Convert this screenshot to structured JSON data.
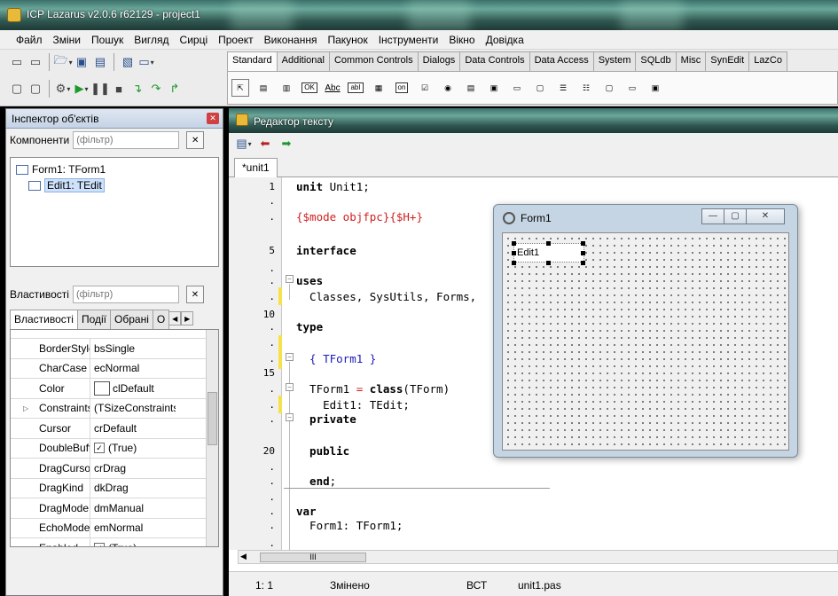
{
  "app": {
    "title": "ICP Lazarus v2.0.6 r62129 - project1"
  },
  "menu": [
    "Файл",
    "Зміни",
    "Пошук",
    "Вигляд",
    "Сирці",
    "Проект",
    "Виконання",
    "Пакунок",
    "Інструменти",
    "Вікно",
    "Довідка"
  ],
  "palette": {
    "tabs": [
      "Standard",
      "Additional",
      "Common Controls",
      "Dialogs",
      "Data Controls",
      "Data Access",
      "System",
      "SQLdb",
      "Misc",
      "SynEdit",
      "LazCo"
    ],
    "active_tab": "Standard",
    "components": [
      "pointer",
      "TMainMenu",
      "TPopupMenu",
      "TButton",
      "TLabel",
      "TEdit",
      "TMemo",
      "TToggleBox",
      "TCheckBox",
      "TRadioButton",
      "TListBox",
      "TComboBox",
      "TScrollBar",
      "TGroupBox",
      "TRadioGroup",
      "TCheckGroup",
      "TPanel",
      "TFrame",
      "TActionList"
    ],
    "labels": {
      "ok": "OK",
      "abc": "Abc",
      "abl": "abI",
      "on": "on"
    }
  },
  "inspector": {
    "title": "Інспектор об'єктів",
    "components_label": "Компоненти",
    "components_filter_placeholder": "(фільтр)",
    "tree": [
      {
        "label": "Form1: TForm1",
        "level": 0
      },
      {
        "label": "Edit1: TEdit",
        "level": 1,
        "selected": true
      }
    ],
    "properties_label": "Властивості",
    "properties_filter_placeholder": "(фільтр)",
    "tabs": [
      "Властивості",
      "Події",
      "Обрані",
      "О"
    ],
    "properties": [
      {
        "name": "BorderStyle",
        "value": "bsSingle"
      },
      {
        "name": "CharCase",
        "value": "ecNormal"
      },
      {
        "name": "Color",
        "value": "clDefault",
        "swatch": true
      },
      {
        "name": "Constraints",
        "value": "(TSizeConstraints)",
        "expandable": true
      },
      {
        "name": "Cursor",
        "value": "crDefault"
      },
      {
        "name": "DoubleBuffered",
        "value": "(True)",
        "checkbox": true
      },
      {
        "name": "DragCursor",
        "value": "crDrag"
      },
      {
        "name": "DragKind",
        "value": "dkDrag"
      },
      {
        "name": "DragMode",
        "value": "dmManual"
      },
      {
        "name": "EchoMode",
        "value": "emNormal"
      },
      {
        "name": "Enabled",
        "value": "(True)",
        "checkbox": true
      }
    ]
  },
  "editor": {
    "title": "Редактор тексту",
    "tab": "*unit1",
    "gutter": [
      {
        "text": "1"
      },
      {
        "text": "."
      },
      {
        "text": "."
      },
      {
        "text": "5"
      },
      {
        "text": "."
      },
      {
        "text": "."
      },
      {
        "text": "."
      },
      {
        "text": "10"
      },
      {
        "text": "."
      },
      {
        "text": "."
      },
      {
        "text": "."
      },
      {
        "text": "15"
      },
      {
        "text": "."
      },
      {
        "text": "."
      },
      {
        "text": "."
      },
      {
        "text": "20"
      },
      {
        "text": "."
      },
      {
        "text": "."
      },
      {
        "text": "."
      }
    ],
    "lines": {
      "l1_kw": "unit",
      "l1_rest": " Unit1;",
      "l3_dir": "{$mode objfpc}{$H+}",
      "l5_kw": "interface",
      "l7_kw": "uses",
      "l8_text": "  Classes, SysUtils, Forms,",
      "l10_kw": "type",
      "l12_cm": "  { TForm1 }",
      "l14_text1": "  TForm1 ",
      "l14_sym": "=",
      "l14_kw": " class",
      "l14_text2": "(TForm)",
      "l15_text": "    Edit1: TEdit;",
      "l16_kw": "  private",
      "l18_kw": "  public",
      "l20_kw": "  end",
      "l20_rest": ";",
      "l22_kw": "var",
      "l23_text": "  Form1: TForm1;"
    },
    "hscroll_thumb": "III",
    "status": {
      "pos": "1: 1",
      "modified": "Змінено",
      "mode": "ВСТ",
      "file": "unit1.pas"
    }
  },
  "form1": {
    "title": "Form1",
    "edit_text": "Edit1",
    "buttons": {
      "minimize": "—",
      "maximize": "▢",
      "close": "✕"
    }
  }
}
